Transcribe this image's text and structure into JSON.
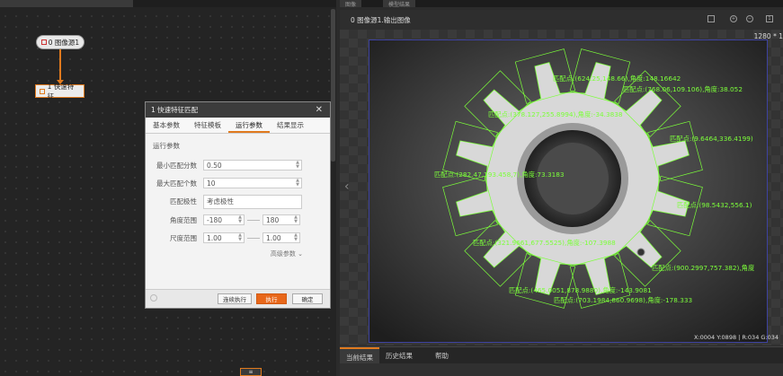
{
  "flow": {
    "node0_label": "0 图像源1",
    "node1_label": "1 快速特征...",
    "bottom_tag": "≡"
  },
  "dialog": {
    "title": "1 快速特征匹配",
    "close": "✕",
    "tabs": [
      "基本参数",
      "特征模板",
      "运行参数",
      "结果显示"
    ],
    "active_tab": 2,
    "section": "运行参数",
    "fields": {
      "min_score": {
        "label": "最小匹配分数",
        "value": "0.50"
      },
      "max_count": {
        "label": "最大匹配个数",
        "value": "10"
      },
      "polarity": {
        "label": "匹配极性",
        "value": "考虑极性"
      },
      "angle": {
        "label": "角度范围",
        "min": "-180",
        "max": "180"
      },
      "scale": {
        "label": "尺度范围",
        "min": "1.00",
        "max": "1.00"
      }
    },
    "advanced": "高级参数 ⌄",
    "buttons": {
      "run_continuous": "连续执行",
      "run": "执行",
      "ok": "确定"
    }
  },
  "viewer": {
    "header_tabs": [
      "图像",
      "模型结果"
    ],
    "title": "0 图像源1.输出图像",
    "resolution": "1280 * 1",
    "status": "X:0004  Y:0898  |  R:034  G:034",
    "results": [
      {
        "text": "匹配点:(624.25,148.66)",
        "angle": ",角度:148.16642"
      },
      {
        "text": "匹配点:(768.06,109.106)",
        "angle": ",角度:38.052"
      },
      {
        "text": "匹配点:(378.127,255.8994)",
        "angle": ",角度:-34.3838"
      },
      {
        "text": "匹配点:(9.6464,336.4199)",
        "angle": ""
      },
      {
        "text": "匹配点:(282.47,193.458,7)",
        "angle": ",角度:73.3183"
      },
      {
        "text": "匹配点:(98.5432,556.1)",
        "angle": ""
      },
      {
        "text": "匹配点:(321.9661,677.5525)",
        "angle": ",角度:-107.3988"
      },
      {
        "text": "匹配点:(900.2997,757.382)",
        "angle": ",角度"
      },
      {
        "text": "匹配点:(465.0051,878.9880)",
        "angle": ",角度:-143.9081"
      },
      {
        "text": "匹配点:(703.1984,860.9698)",
        "angle": ",角度:-178.333"
      }
    ]
  },
  "bottom_tabs": [
    "当前结果",
    "历史结果",
    "帮助"
  ],
  "colors": {
    "accent": "#e8671a",
    "match": "#7cff3a",
    "frame": "#3d42a0"
  }
}
